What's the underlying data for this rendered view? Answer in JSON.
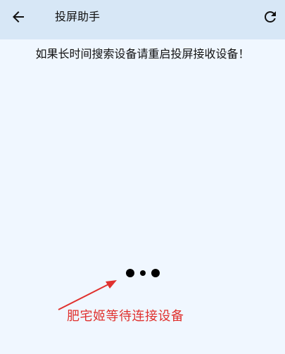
{
  "header": {
    "title": "投屏助手",
    "back_icon": "arrow-left-icon",
    "refresh_icon": "refresh-icon"
  },
  "main": {
    "hint": "如果长时间搜索设备请重启投屏接收设备！",
    "loading_icon": "loading-dots-icon"
  },
  "annotation": {
    "text": "肥宅姬等待连接设备",
    "color": "#e0312e"
  }
}
